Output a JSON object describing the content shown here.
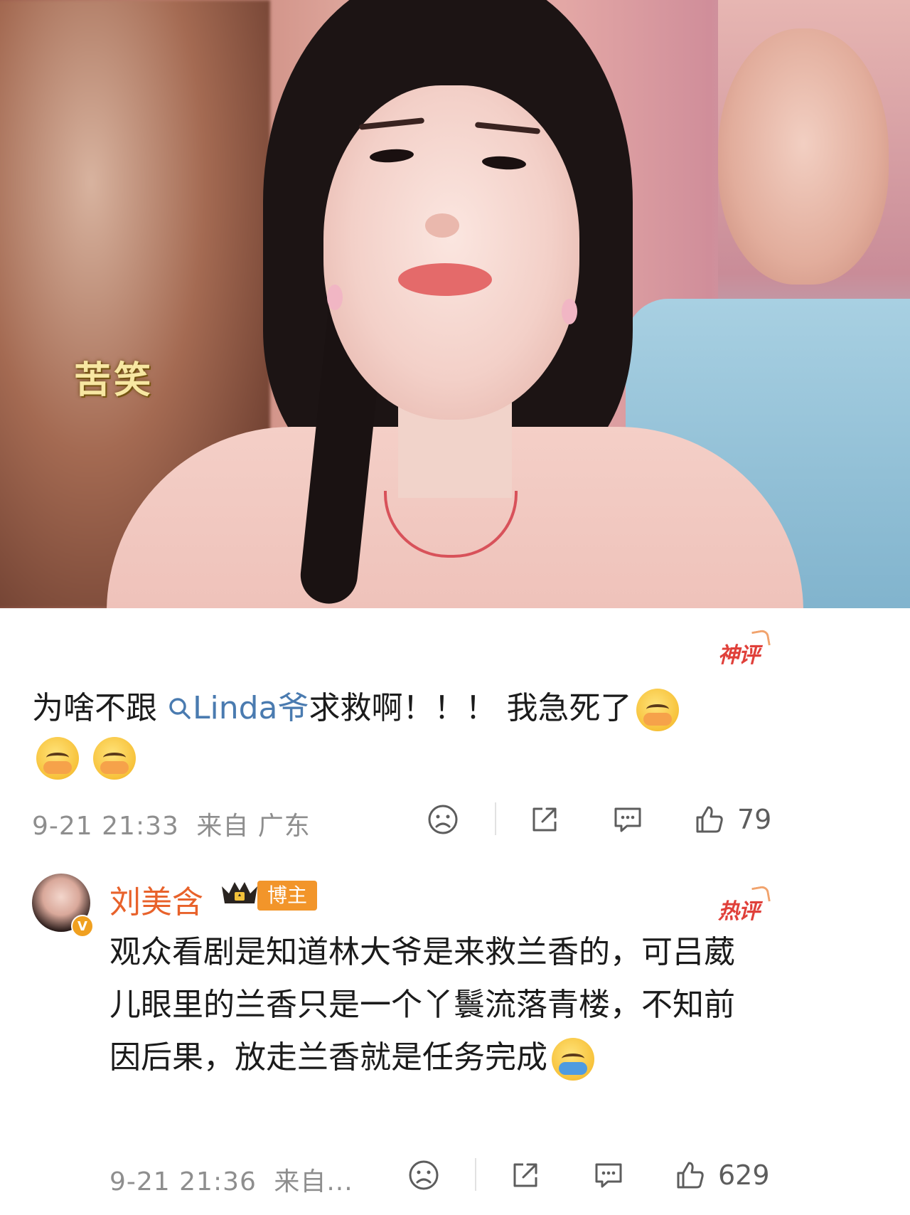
{
  "image": {
    "caption": "苦笑"
  },
  "comment1": {
    "badge": "神评",
    "text_before": "为啥不跟",
    "mention_icon": "search-icon",
    "mention": "Linda爷",
    "text_after": "求救啊！！！ 我急死了",
    "emojis": [
      "crying-face",
      "crying-face",
      "crying-face"
    ],
    "time": "9-21 21:33",
    "location": "来自 广东",
    "like_count": "79"
  },
  "comment2": {
    "username": "刘美含",
    "crown_icon": "crown-icon",
    "role_tag": "博主",
    "badge": "热评",
    "text": "观众看剧是知道林大爷是来救兰香的，可吕葳儿眼里的兰香只是一个丫鬟流落青楼，不知前因后果，放走兰香就是任务完成",
    "emoji": "hug-emoji",
    "time": "9-21 21:36",
    "location": "来自...",
    "like_count": "629"
  },
  "colors": {
    "accent_red": "#e0403a",
    "mention_blue": "#4a7bb0",
    "username_orange": "#e8622b",
    "tag_orange": "#f2952a",
    "meta_gray": "#8e8e8e"
  }
}
